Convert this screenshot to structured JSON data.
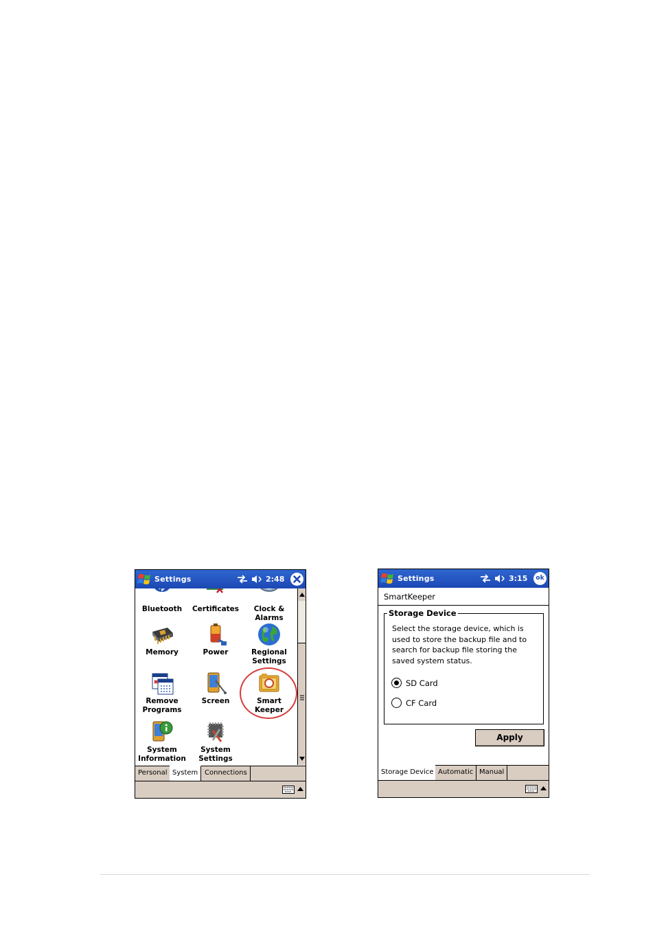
{
  "left_screen": {
    "title": "Settings",
    "time": "2:48",
    "close_icon": "close-x-icon",
    "icons": [
      {
        "label": "Bluetooth",
        "icon": "bluetooth-icon"
      },
      {
        "label": "Certificates",
        "icon": "certificates-icon"
      },
      {
        "label": "Clock &\nAlarms",
        "icon": "clock-icon"
      },
      {
        "label": "Memory",
        "icon": "memory-chip-icon"
      },
      {
        "label": "Power",
        "icon": "battery-icon"
      },
      {
        "label": "Regional\nSettings",
        "icon": "globe-icon"
      },
      {
        "label": "Remove\nPrograms",
        "icon": "remove-programs-icon"
      },
      {
        "label": "Screen",
        "icon": "screen-icon"
      },
      {
        "label": "Smart\nKeeper",
        "icon": "smart-keeper-icon"
      },
      {
        "label": "System\nInformation",
        "icon": "system-information-icon"
      },
      {
        "label": "System\nSettings",
        "icon": "system-settings-icon"
      }
    ],
    "tabs": [
      "Personal",
      "System",
      "Connections"
    ],
    "active_tab": "System"
  },
  "right_screen": {
    "title": "Settings",
    "time": "3:15",
    "ok_label": "ok",
    "app_title": "SmartKeeper",
    "group_title": "Storage Device",
    "description": "Select the storage device, which is used to store the backup file and to search for backup file storing the saved system status.",
    "options": [
      {
        "label": "SD Card",
        "checked": true
      },
      {
        "label": "CF Card",
        "checked": false
      }
    ],
    "apply_label": "Apply",
    "tabs": [
      "Storage Device",
      "Automatic",
      "Manual"
    ],
    "active_tab": "Storage Device"
  },
  "colors": {
    "titlebar": "#1c48b4",
    "chrome": "#d9cdc2",
    "highlight": "#d63b3b"
  }
}
